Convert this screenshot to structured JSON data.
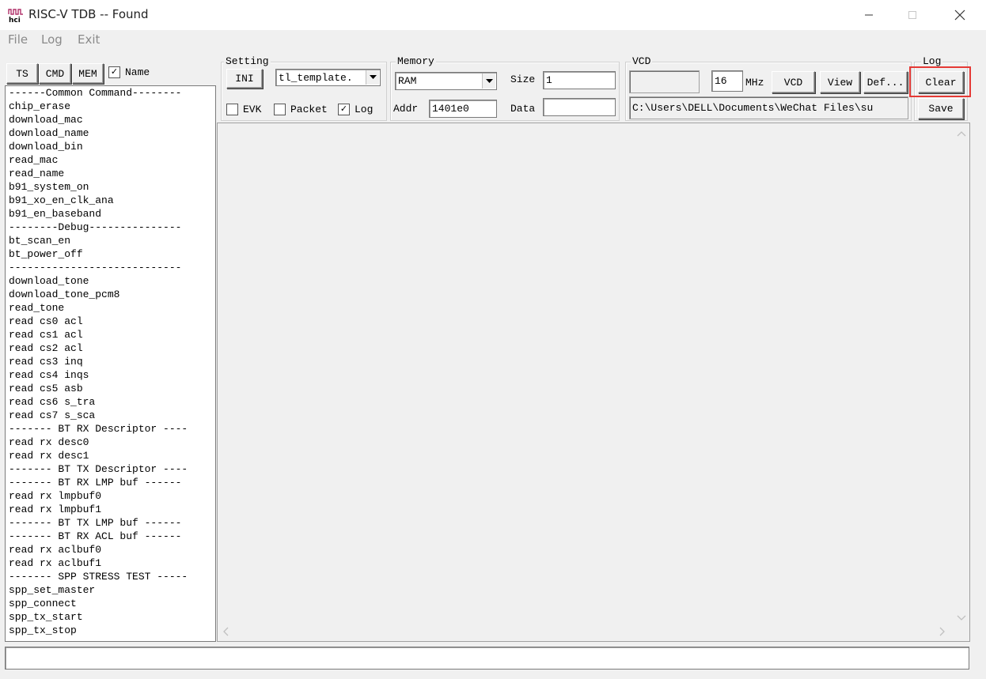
{
  "window": {
    "title": "RISC-V TDB -- Found",
    "app_icon_text": "hci",
    "minimize_icon": "minimize-icon",
    "maximize_icon": "maximize-icon",
    "close_icon": "close-icon"
  },
  "menu": [
    "File",
    "Log",
    "Exit"
  ],
  "left_tabs": {
    "ts": "TS",
    "cmd": "CMD",
    "mem": "MEM",
    "name_label": "Name",
    "name_checked": true
  },
  "command_list": [
    "------Common Command--------",
    "chip_erase",
    "download_mac",
    "download_name",
    "download_bin",
    "read_mac",
    "read_name",
    "b91_system_on",
    "b91_xo_en_clk_ana",
    "b91_en_baseband",
    "--------Debug---------------",
    "bt_scan_en",
    "bt_power_off",
    "----------------------------",
    "download_tone",
    "download_tone_pcm8",
    "read_tone",
    "read cs0 acl",
    "read cs1 acl",
    "read cs2 acl",
    "read cs3 inq",
    "read cs4 inqs",
    "read cs5 asb",
    "read cs6 s_tra",
    "read cs7 s_sca",
    "------- BT RX Descriptor ----",
    "read rx desc0",
    "read rx desc1",
    "------- BT TX Descriptor ----",
    "------- BT RX LMP buf ------",
    "read rx lmpbuf0",
    "read rx lmpbuf1",
    "------- BT TX LMP buf ------",
    "------- BT RX ACL buf ------",
    "read rx aclbuf0",
    "read rx aclbuf1",
    "------- SPP STRESS TEST -----",
    "spp_set_master",
    "spp_connect",
    "spp_tx_start",
    "spp_tx_stop"
  ],
  "setting": {
    "title": "Setting",
    "ini_button": "INI",
    "template_value": "tl_template.",
    "evk_label": "EVK",
    "evk_checked": false,
    "packet_label": "Packet",
    "packet_checked": false,
    "log_label": "Log",
    "log_checked": true
  },
  "memory": {
    "title": "Memory",
    "type_value": "RAM",
    "size_label": "Size",
    "size_value": "1",
    "addr_label": "Addr",
    "addr_value": "1401e0",
    "data_label": "Data",
    "data_value": ""
  },
  "vcd": {
    "title": "VCD",
    "freq_value": "16",
    "freq_unit": "MHz",
    "vcd_button": "VCD",
    "view_button": "View",
    "def_button": "Def...",
    "path_value": "C:\\Users\\DELL\\Documents\\WeChat Files\\su"
  },
  "log": {
    "title": "Log",
    "clear_button": "Clear",
    "save_button": "Save"
  },
  "command_input": {
    "value": ""
  },
  "colors": {
    "highlight": "#e53935",
    "window_bg": "#f0f0f0"
  }
}
